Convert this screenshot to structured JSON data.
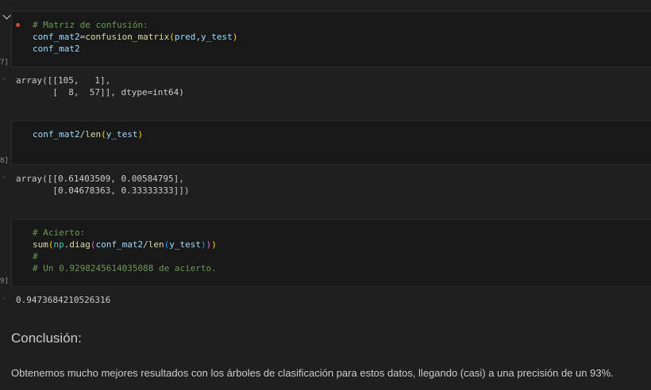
{
  "cells": [
    {
      "exec_count": "7]",
      "code": {
        "line1": "# Matriz de confusión:",
        "line2_var": "conf_mat2",
        "line2_eq": "=",
        "line2_fn": "confusion_matrix",
        "line2_open": "(",
        "line2_arg1": "pred",
        "line2_comma": ",",
        "line2_arg2": "y_test",
        "line2_close": ")",
        "line3": "conf_mat2"
      },
      "output": "array([[105,   1],\n       [  8,  57]], dtype=int64)"
    },
    {
      "exec_count": "8]",
      "code": {
        "var": "conf_mat2",
        "div": "/",
        "fn": "len",
        "open": "(",
        "arg": "y_test",
        "close": ")"
      },
      "output": "array([[0.61403509, 0.00584795],\n       [0.04678363, 0.33333333]])"
    },
    {
      "exec_count": "9]",
      "code": {
        "line1": "# Acierto:",
        "line2_sum": "sum",
        "line2_p1": "(",
        "line2_np": "np",
        "line2_dot": ".",
        "line2_diag": "diag",
        "line2_p2": "(",
        "line2_var": "conf_mat2",
        "line2_div": "/",
        "line2_len": "len",
        "line2_p3": "(",
        "line2_arg": "y_test",
        "line2_c3": ")",
        "line2_c2": ")",
        "line2_c1": ")",
        "line3": "#",
        "line4": "# Un 0.9298245614035088 de acierto."
      },
      "output": "0.9473684210526316"
    }
  ],
  "markdown": {
    "heading": "Conclusión:",
    "text": "Obtenemos mucho mejores resultados con los árboles de clasificación para estos datos, llegando (casi) a una precisión de un 93%."
  },
  "output_marker": "·"
}
